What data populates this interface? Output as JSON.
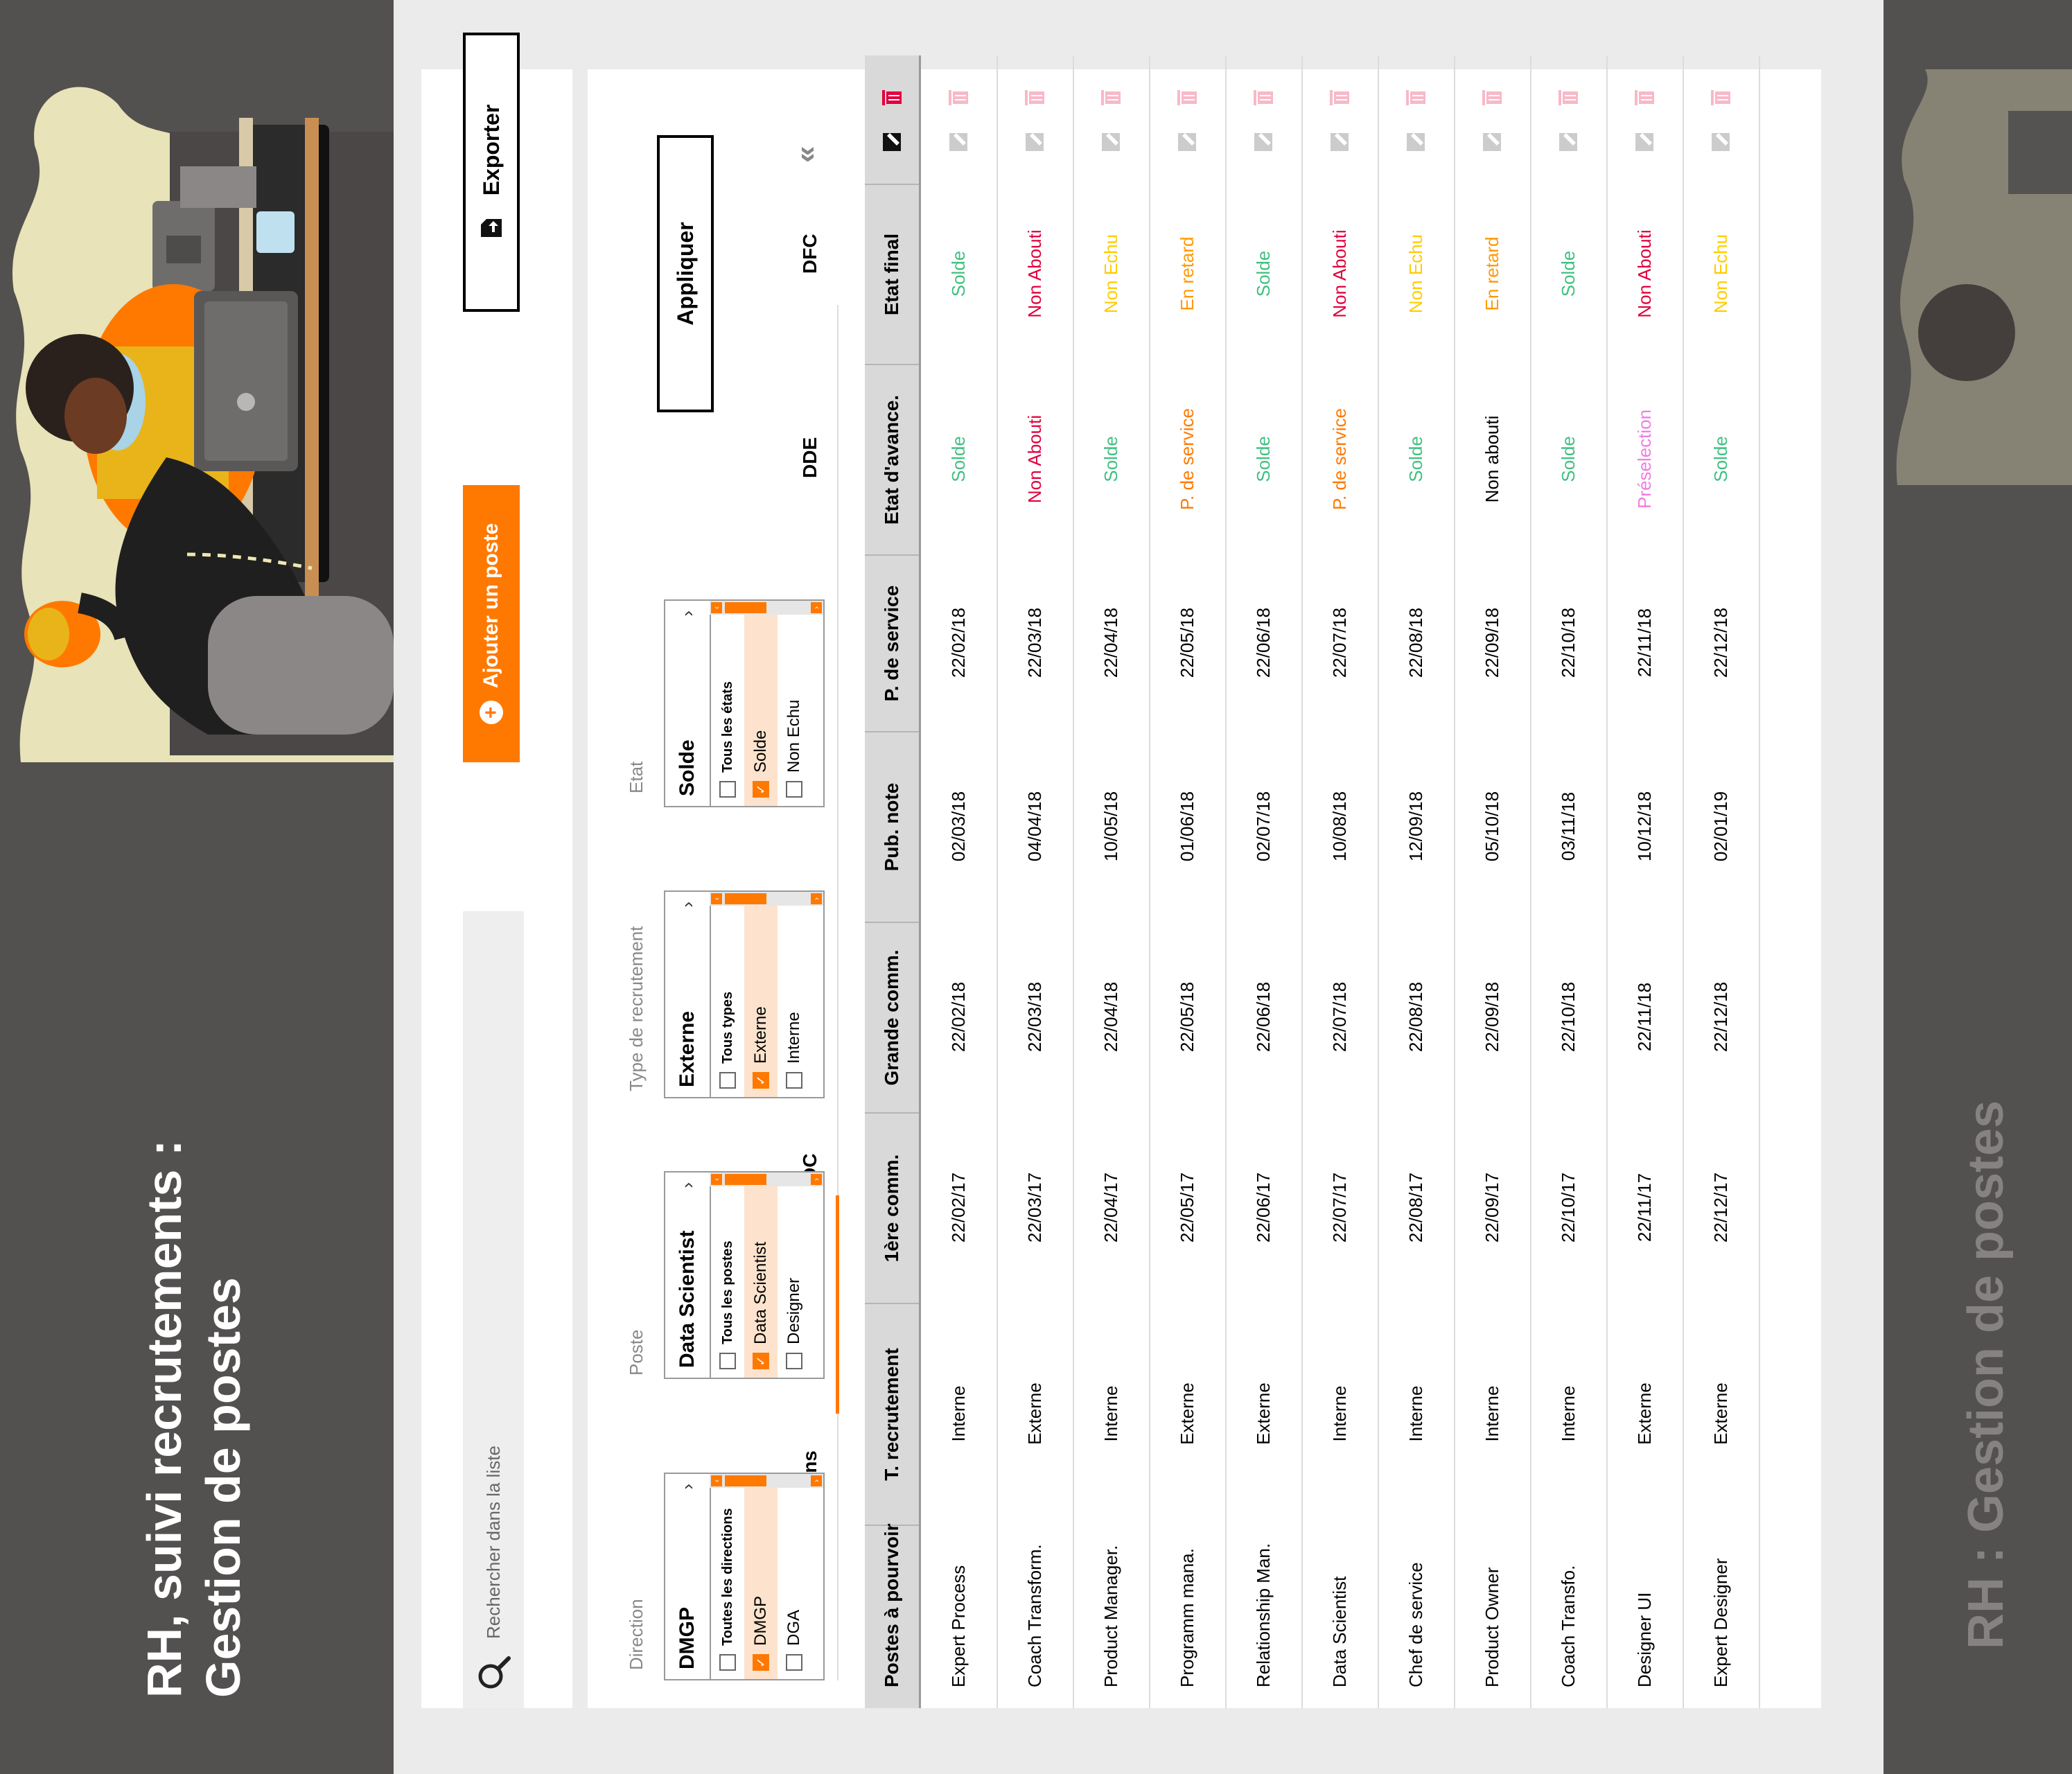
{
  "left": {
    "title_line1": "RH, suivi recrutements :",
    "title_line2": "Gestion de postes"
  },
  "right": {
    "title": "RH : Gestion de postes"
  },
  "toolbar": {
    "search_placeholder": "Rechercher dans la liste",
    "add_label": "Ajouter un poste",
    "export_label": "Exporter"
  },
  "filters": {
    "direction": {
      "label": "Direction",
      "selected": "DMGP",
      "options": [
        "Toutes les directions",
        "DMGP",
        "DGA"
      ],
      "checked": [
        false,
        true,
        false
      ]
    },
    "poste": {
      "label": "Poste",
      "selected": "Data Scientist",
      "options": [
        "Tous les postes",
        "Data Scientist",
        "Designer"
      ],
      "checked": [
        false,
        true,
        false
      ]
    },
    "type": {
      "label": "Type de recrutement",
      "selected": "Externe",
      "options": [
        "Tous types",
        "Externe",
        "Interne"
      ],
      "checked": [
        false,
        true,
        false
      ]
    },
    "etat": {
      "label": "Etat",
      "selected": "Solde",
      "options": [
        "Tous les états",
        "Solde",
        "Non Echu"
      ],
      "checked": [
        false,
        true,
        false
      ]
    },
    "apply_label": "Appliquer"
  },
  "direction_tabs": [
    "tions",
    "DC",
    "DDE",
    "DFC"
  ],
  "table": {
    "headers": [
      "Postes à pourvoir",
      "T. recrutement",
      "1ère comm.",
      "Grande comm.",
      "Pub. note",
      "P. de service",
      "Etat d'avance.",
      "Etat final"
    ],
    "rows": [
      {
        "poste": "Expert Process",
        "type": "Interne",
        "first": "22/02/17",
        "grande": "22/02/18",
        "pub": "02/03/18",
        "service": "22/02/18",
        "avance": "Solde",
        "final": "Solde"
      },
      {
        "poste": "Coach Transform.",
        "type": "Externe",
        "first": "22/03/17",
        "grande": "22/03/18",
        "pub": "04/04/18",
        "service": "22/03/18",
        "avance": "Non Abouti",
        "final": "Non Abouti"
      },
      {
        "poste": "Product Manager.",
        "type": "Interne",
        "first": "22/04/17",
        "grande": "22/04/18",
        "pub": "10/05/18",
        "service": "22/04/18",
        "avance": "Solde",
        "final": "Non Echu"
      },
      {
        "poste": "Programm mana.",
        "type": "Externe",
        "first": "22/05/17",
        "grande": "22/05/18",
        "pub": "01/06/18",
        "service": "22/05/18",
        "avance": "P. de service",
        "final": "En retard"
      },
      {
        "poste": "Relationship Man.",
        "type": "Externe",
        "first": "22/06/17",
        "grande": "22/06/18",
        "pub": "02/07/18",
        "service": "22/06/18",
        "avance": "Solde",
        "final": "Solde"
      },
      {
        "poste": "Data Scientist",
        "type": "Interne",
        "first": "22/07/17",
        "grande": "22/07/18",
        "pub": "10/08/18",
        "service": "22/07/18",
        "avance": "P. de service",
        "final": "Non Abouti"
      },
      {
        "poste": "Chef de service",
        "type": "Interne",
        "first": "22/08/17",
        "grande": "22/08/18",
        "pub": "12/09/18",
        "service": "22/08/18",
        "avance": "Solde",
        "final": "Non Echu"
      },
      {
        "poste": "Product Owner",
        "type": "Interne",
        "first": "22/09/17",
        "grande": "22/09/18",
        "pub": "05/10/18",
        "service": "22/09/18",
        "avance": "Non abouti",
        "final": "En retard"
      },
      {
        "poste": "Coach Transfo.",
        "type": "Interne",
        "first": "22/10/17",
        "grande": "22/10/18",
        "pub": "03/11/18",
        "service": "22/10/18",
        "avance": "Solde",
        "final": "Solde"
      },
      {
        "poste": "Designer UI",
        "type": "Externe",
        "first": "22/11/17",
        "grande": "22/11/18",
        "pub": "10/12/18",
        "service": "22/11/18",
        "avance": "Préselection",
        "final": "Non Abouti"
      },
      {
        "poste": "Expert Designer",
        "type": "Externe",
        "first": "22/12/17",
        "grande": "22/12/18",
        "pub": "02/01/19",
        "service": "22/12/18",
        "avance": "Solde",
        "final": "Non Echu"
      }
    ]
  },
  "status_colors": {
    "Solde": "#3fbf80",
    "Non Abouti": "#e0003c",
    "Non Echu": "#ffcc00",
    "En retard": "#ff9900",
    "P. de service": "#ff7900",
    "Préselection": "#f07ce0",
    "Non abouti": "#000000"
  },
  "accent_color": "#ff7900"
}
